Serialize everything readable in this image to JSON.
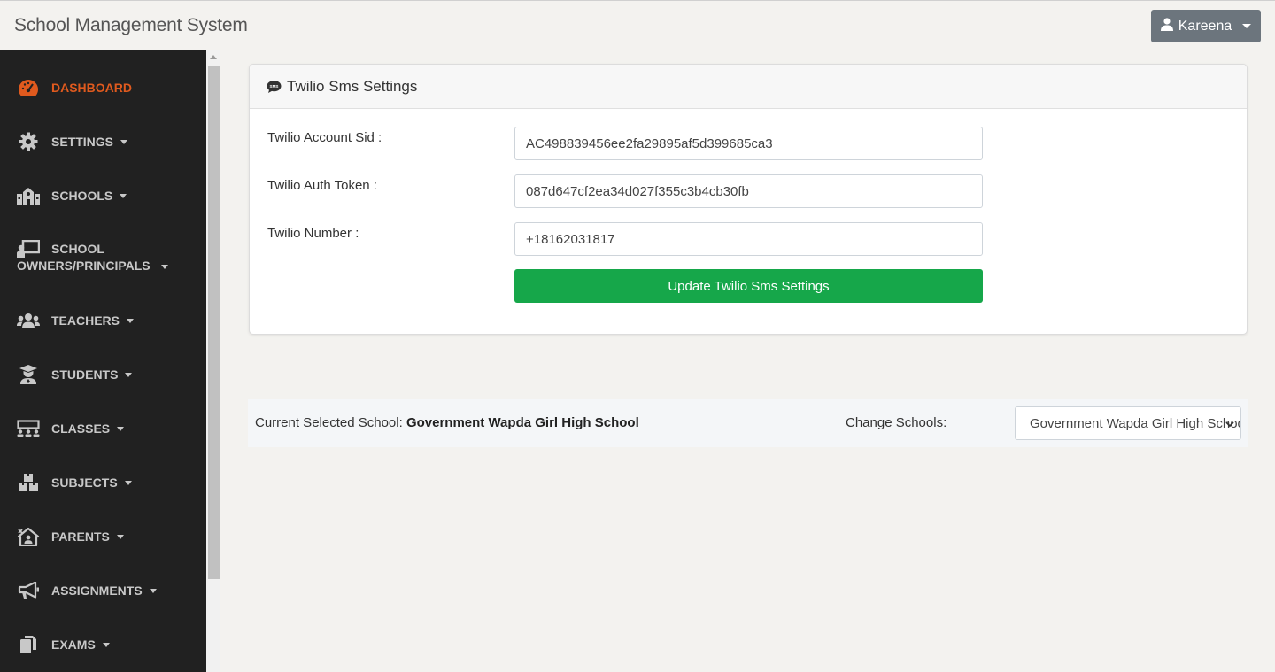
{
  "app": {
    "title": "School Management System"
  },
  "user": {
    "name": "Kareena"
  },
  "sidebar": {
    "items": [
      {
        "label": "DASHBOARD",
        "icon": "tachometer-icon",
        "active": true
      },
      {
        "label": "SETTINGS",
        "icon": "gear-icon"
      },
      {
        "label": "SCHOOLS",
        "icon": "school-icon"
      },
      {
        "label_line1": "SCHOOL",
        "label_line2": "OWNERS/PRINCIPALS",
        "icon": "chalkboard-teacher-icon"
      },
      {
        "label": "TEACHERS",
        "icon": "users-icon"
      },
      {
        "label": "STUDENTS",
        "icon": "graduate-icon"
      },
      {
        "label": "CLASSES",
        "icon": "classroom-icon"
      },
      {
        "label": "SUBJECTS",
        "icon": "boxes-icon"
      },
      {
        "label": "PARENTS",
        "icon": "house-user-icon"
      },
      {
        "label": "ASSIGNMENTS",
        "icon": "bullhorn-icon"
      },
      {
        "label": "EXAMS",
        "icon": "copy-icon"
      }
    ]
  },
  "settings_card": {
    "title": "Twilio Sms Settings",
    "icon": "sms-icon",
    "fields": [
      {
        "label": "Twilio Account Sid :",
        "value": "AC498839456ee2fa29895af5d399685ca3"
      },
      {
        "label": "Twilio Auth Token :",
        "value": "087d647cf2ea34d027f355c3b4cb30fb"
      },
      {
        "label": "Twilio Number :",
        "value": "+18162031817"
      }
    ],
    "submit_label": "Update Twilio Sms Settings"
  },
  "school_bar": {
    "current_label": "Current Selected School:",
    "current_value": "Government Wapda Girl High School",
    "change_label": "Change Schools:",
    "selected_option": "Government Wapda Girl High School"
  },
  "colors": {
    "sidebar_bg": "#212121",
    "active_accent": "#e05a1e",
    "submit_green": "#16a74a",
    "user_button": "#6c757d"
  }
}
